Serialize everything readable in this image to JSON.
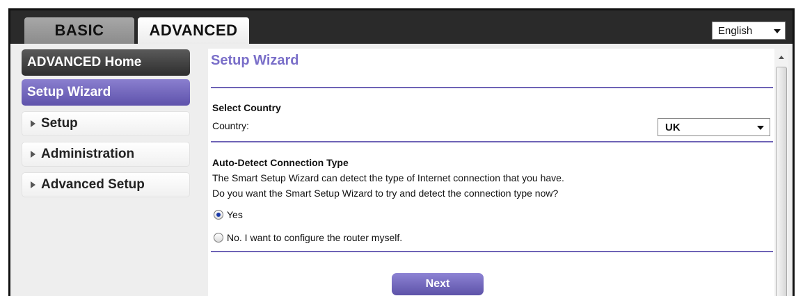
{
  "tabs": {
    "basic": "BASIC",
    "advanced": "ADVANCED"
  },
  "language": {
    "selected": "English"
  },
  "sidebar": {
    "home": "ADVANCED Home",
    "wizard": "Setup Wizard",
    "items": [
      "Setup",
      "Administration",
      "Advanced Setup"
    ]
  },
  "main": {
    "title": "Setup Wizard",
    "country_section": {
      "heading": "Select Country",
      "label": "Country:",
      "selected": "UK"
    },
    "autodetect": {
      "heading": "Auto-Detect Connection Type",
      "line1": "The Smart Setup Wizard can detect the type of Internet connection that you have.",
      "line2": "Do you want the Smart Setup Wizard to try and detect the connection type now?",
      "option_yes": "Yes",
      "option_no": "No. I want to configure the router myself.",
      "selected": "yes"
    },
    "next_label": "Next"
  },
  "colors": {
    "accent": "#6e63b6",
    "title": "#7a6fc9",
    "topbar": "#2a2a2a"
  }
}
